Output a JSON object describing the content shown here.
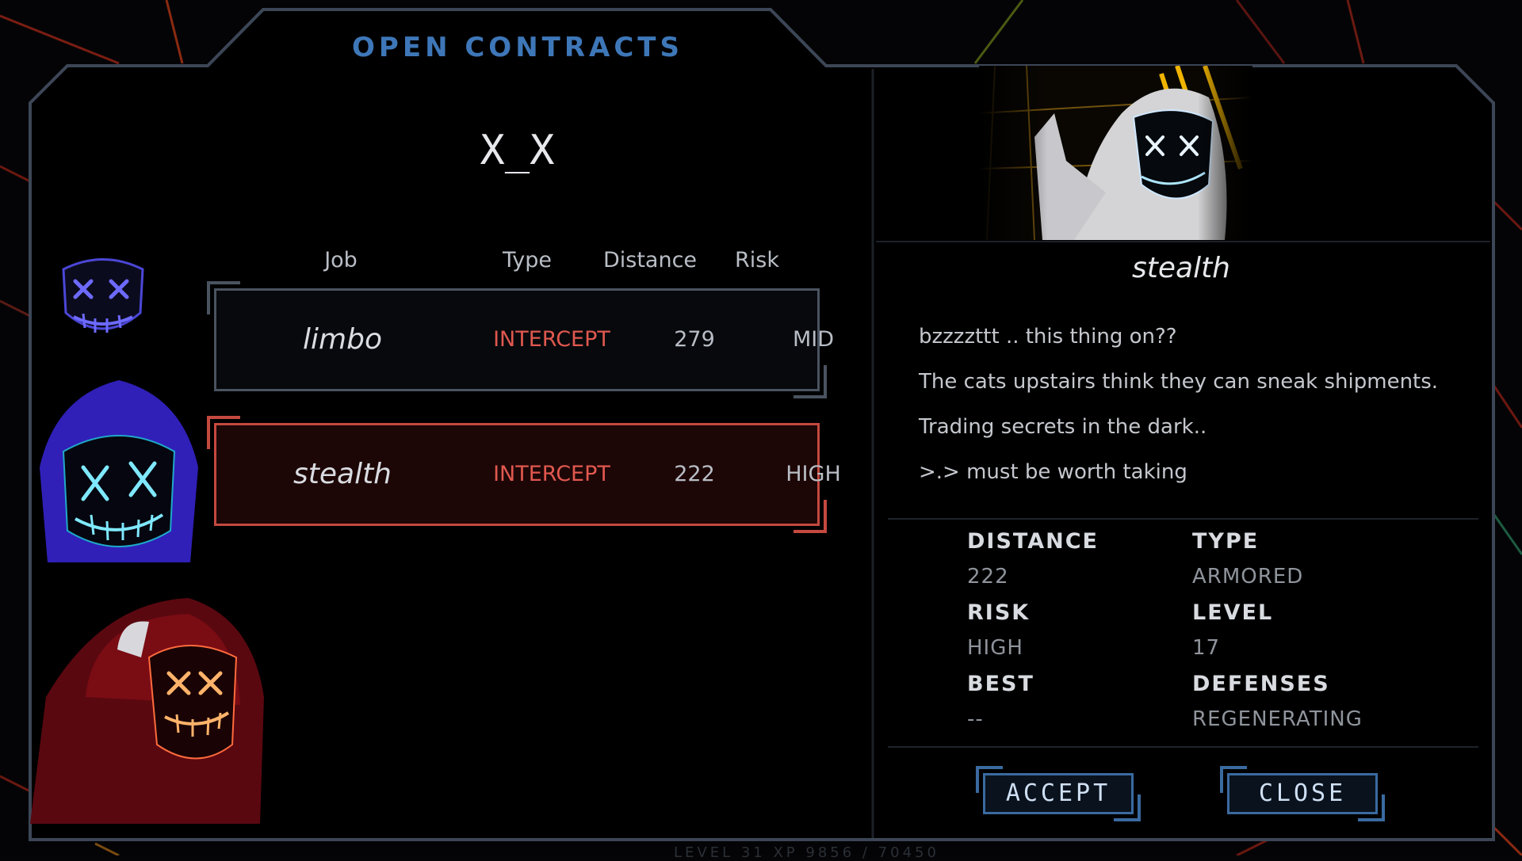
{
  "window": {
    "title": "OPEN CONTRACTS",
    "player_name": "X_X"
  },
  "table": {
    "columns": [
      "Job",
      "Type",
      "Distance",
      "Risk"
    ],
    "rows": [
      {
        "job": "limbo",
        "type": "INTERCEPT",
        "distance": "279",
        "risk": "MID",
        "selected": false
      },
      {
        "job": "stealth",
        "type": "INTERCEPT",
        "distance": "222",
        "risk": "HIGH",
        "selected": true
      }
    ]
  },
  "avatars": [
    "purple-mask-avatar",
    "blue-hooded-mask-avatar",
    "red-hooded-mask-avatar"
  ],
  "detail": {
    "name": "stealth",
    "messages": [
      "bzzzzttt .. this thing on??",
      "The cats upstairs think they can sneak shipments.",
      "Trading secrets in the dark..",
      ">.> must be worth taking"
    ],
    "stats": {
      "distance_label": "DISTANCE",
      "distance": "222",
      "type_label": "TYPE",
      "type": "ARMORED",
      "risk_label": "RISK",
      "risk": "HIGH",
      "level_label": "LEVEL",
      "level": "17",
      "best_label": "BEST",
      "best": "--",
      "defenses_label": "DEFENSES",
      "defenses": "REGENERATING"
    }
  },
  "buttons": {
    "accept": "ACCEPT",
    "close": "CLOSE"
  },
  "footer": "LEVEL 31   XP 9856 / 70450",
  "colors": {
    "accent_blue": "#3e77b8",
    "danger_red": "#e0584f",
    "selected_border": "#c4493f",
    "frame": "#3c4656"
  }
}
